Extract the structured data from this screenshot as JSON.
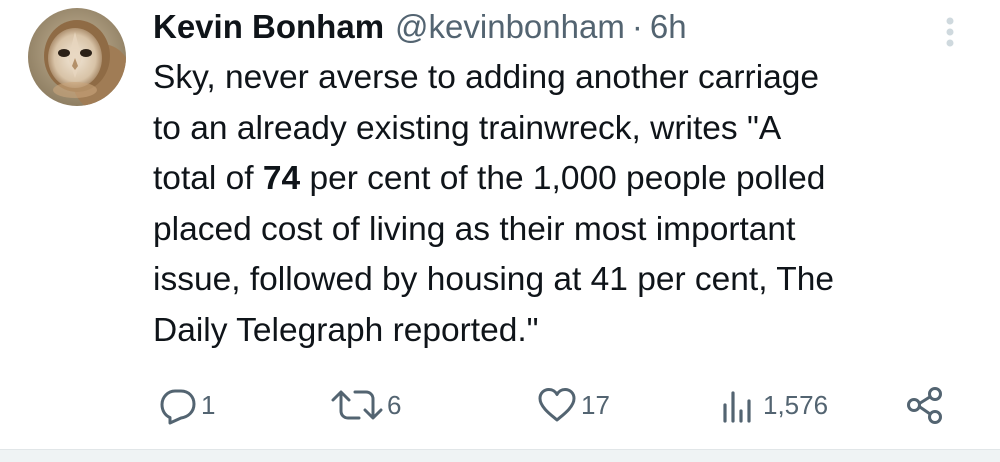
{
  "author": {
    "name": "Kevin Bonham",
    "handle": "@kevinbonham",
    "separator": "·",
    "time": "6h"
  },
  "tweet": {
    "lines": [
      {
        "pre": "Sky, never averse to adding another carriage",
        "bold": "",
        "post": ""
      },
      {
        "pre": "to an already existing trainwreck, writes \"A",
        "bold": "",
        "post": ""
      },
      {
        "pre": "total of ",
        "bold": "74",
        "post": " per cent of the 1,000 people polled"
      },
      {
        "pre": "placed cost of living as their most important",
        "bold": "",
        "post": ""
      },
      {
        "pre": "issue, followed by housing at 41 per cent, The",
        "bold": "",
        "post": ""
      },
      {
        "pre": "Daily Telegraph reported.\"",
        "bold": "",
        "post": ""
      }
    ]
  },
  "actions": {
    "reply_count": "1",
    "retweet_count": "6",
    "like_count": "17",
    "views_count": "1,576"
  },
  "icons": {
    "avatar": "barn-owl-avatar",
    "more": "more-vertical-icon",
    "reply": "reply-icon",
    "retweet": "retweet-icon",
    "like": "heart-icon",
    "views": "views-icon",
    "share": "share-icon"
  },
  "colors": {
    "text": "#0f1419",
    "secondary": "#536471",
    "more_dots": "#cfd9de"
  }
}
